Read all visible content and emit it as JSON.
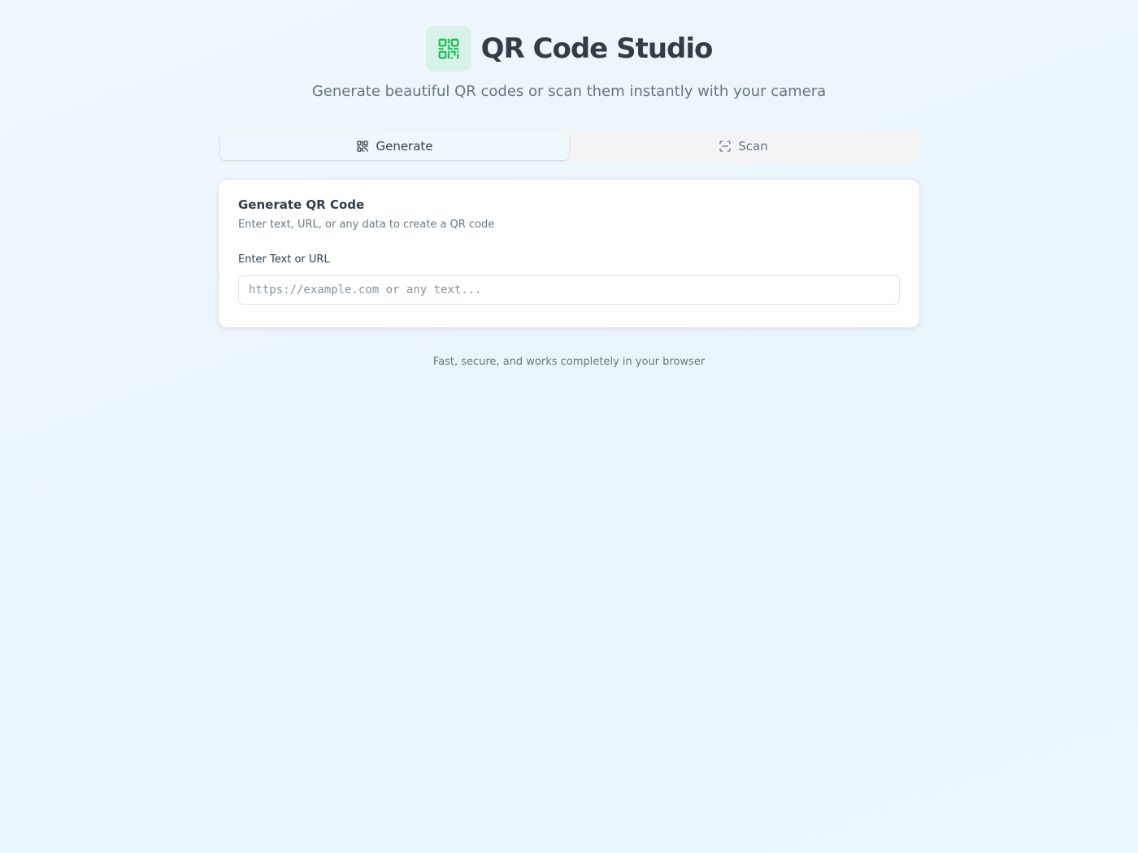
{
  "header": {
    "title": "QR Code Studio",
    "subtitle": "Generate beautiful QR codes or scan them instantly with your camera",
    "logo_icon": "qr-code-icon"
  },
  "tabs": [
    {
      "label": "Generate",
      "icon": "qr-code-icon",
      "active": true
    },
    {
      "label": "Scan",
      "icon": "scan-icon",
      "active": false
    }
  ],
  "generate_card": {
    "title": "Generate QR Code",
    "description": "Enter text, URL, or any data to create a QR code",
    "input_label": "Enter Text or URL",
    "input_value": "",
    "input_placeholder": "https://example.com or any text..."
  },
  "footer": {
    "text": "Fast, secure, and works completely in your browser"
  },
  "colors": {
    "accent": "#22c55e",
    "logo_bg": "#d8f2ea",
    "text_primary": "#333d47",
    "text_muted": "#687482"
  }
}
